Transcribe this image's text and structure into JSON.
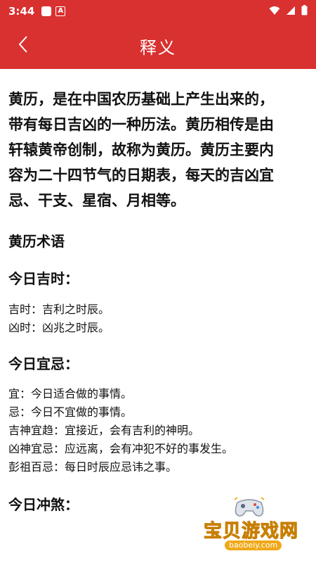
{
  "status_bar": {
    "time": "3:44",
    "notif_icon": "A",
    "icons": [
      "wifi-icon",
      "signal-icon",
      "battery-icon"
    ]
  },
  "app_bar": {
    "title": "释义",
    "back_icon": "chevron-left-icon",
    "background_color": "#d93030"
  },
  "content": {
    "intro_lines": [
      "黄历，是在中国农历基础上产生出来的，",
      "带有每日吉凶的一种历法。黄历相传是由",
      "轩辕黄帝创制，故称为黄历。黄历主要内",
      "容为二十四节气的日期表，每天的吉凶宜",
      "忌、干支、星宿、月相等。"
    ],
    "terms_heading": "黄历术语",
    "sections": [
      {
        "heading": "今日吉时：",
        "items": [
          "吉时：吉利之时辰。",
          "凶时：凶兆之时辰。"
        ]
      },
      {
        "heading": "今日宜忌：",
        "items": [
          "宜：今日适合做的事情。",
          "忌：今日不宜做的事情。",
          "吉神宜趋：宜接近，会有吉利的神明。",
          "凶神宜忌：应远离，会有冲犯不好的事发生。",
          "彭祖百忌：每日时辰应忌讳之事。"
        ]
      },
      {
        "heading": "今日冲煞："
      }
    ]
  },
  "watermark": {
    "title": "宝贝游戏网",
    "url": "baobeiy.com"
  }
}
